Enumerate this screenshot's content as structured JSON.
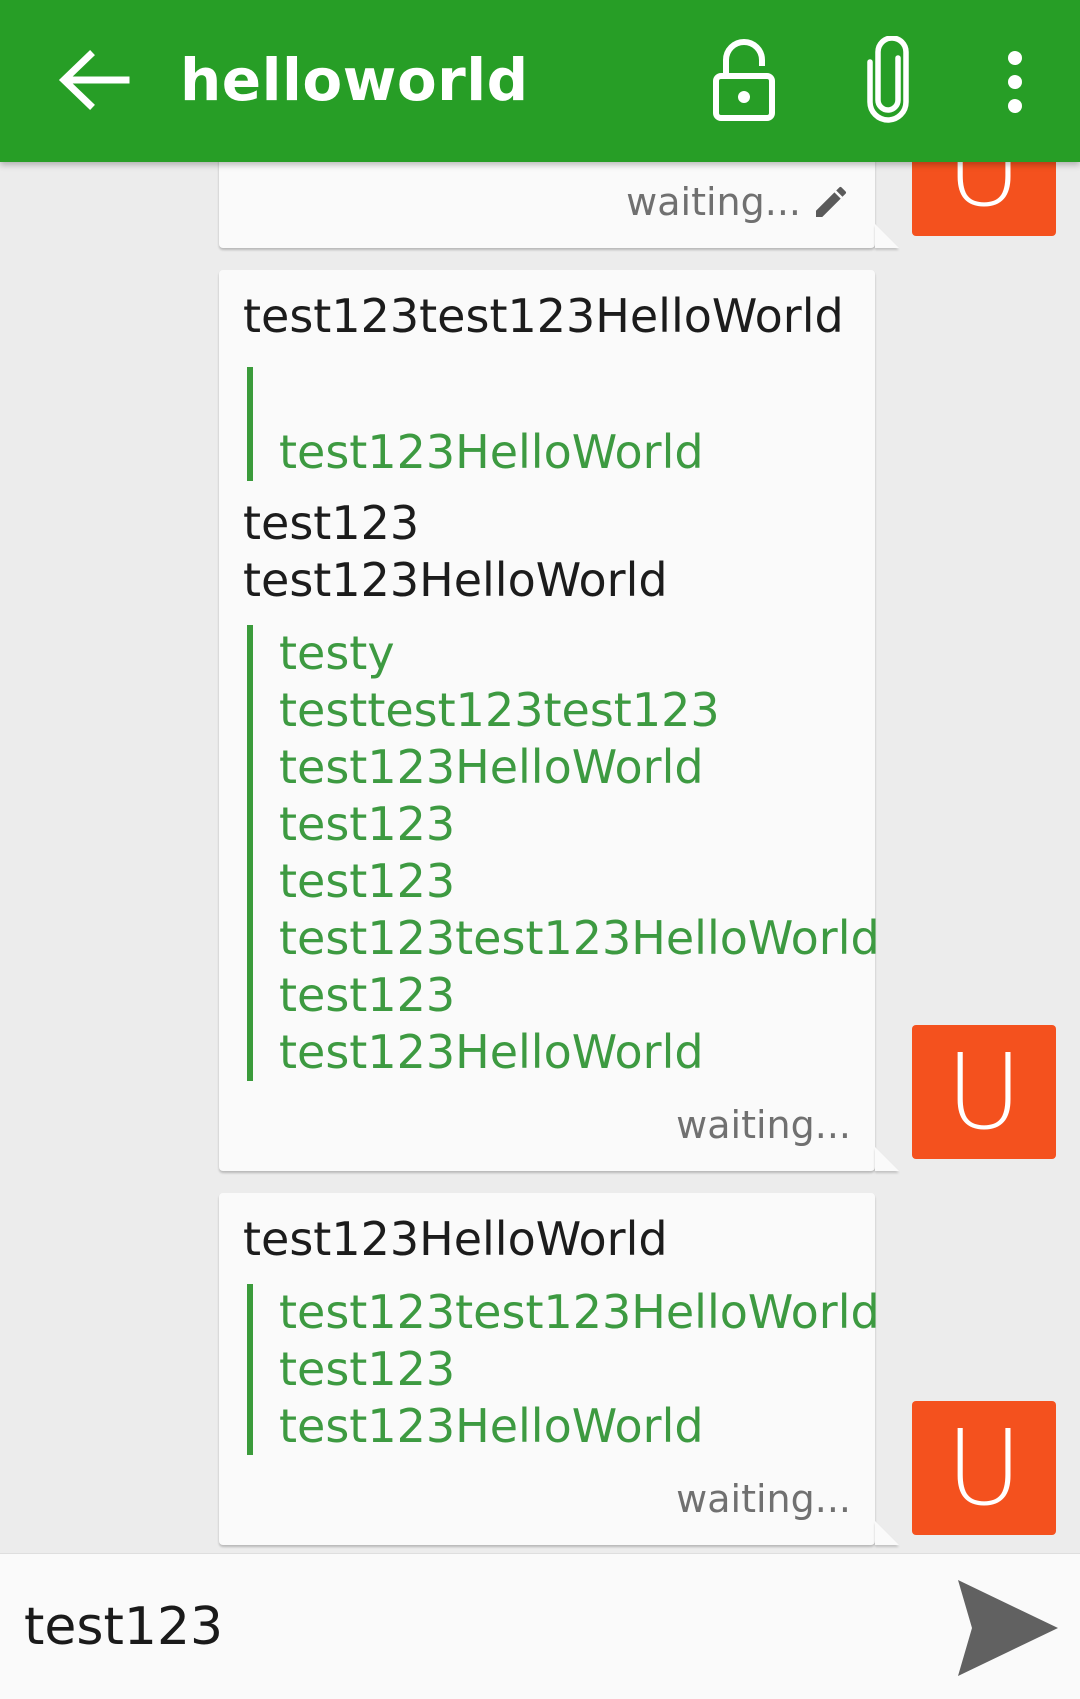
{
  "header": {
    "title": "helloworld",
    "bg_color": "#279e26",
    "back_icon": "arrow-left-icon",
    "lock_icon": "lock-open-icon",
    "attach_icon": "paperclip-icon",
    "menu_icon": "more-vertical-icon"
  },
  "messages": [
    {
      "status": "waiting...",
      "edited": true,
      "avatar": "U"
    },
    {
      "text": "test123test123HelloWorld",
      "quote1": [
        "",
        "test123HelloWorld"
      ],
      "body": [
        "test123",
        "test123HelloWorld"
      ],
      "quote2": [
        "testy",
        "testtest123test123",
        "test123HelloWorld",
        "test123",
        "test123",
        "test123test123HelloWorld",
        "test123",
        "test123HelloWorld"
      ],
      "status": "waiting...",
      "avatar": "U"
    },
    {
      "text": "test123HelloWorld",
      "quote": [
        "test123test123HelloWorld",
        "test123",
        "test123HelloWorld"
      ],
      "status": "waiting...",
      "avatar": "U"
    }
  ],
  "composer": {
    "value": "test123",
    "send_icon": "send-icon"
  },
  "colors": {
    "quote_text": "#3d9a41",
    "avatar_bg": "#f4511e"
  }
}
